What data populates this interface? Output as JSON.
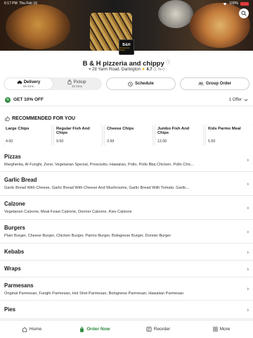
{
  "status_bar": {
    "time": "6:17 PM",
    "date": "Thu Feb 16",
    "battery": "100%"
  },
  "restaurant": {
    "logo_text": "B&H",
    "logo_sub": "Pizzeria and Chippy",
    "name": "B & H pizzeria and chippy",
    "address": "28 Yarm Road, Darlington",
    "rating": "4.7",
    "rating_count": "(1.7k+)"
  },
  "order_mode": {
    "delivery_label": "Delivery",
    "delivery_time": "55 mins",
    "pickup_label": "Pickup",
    "pickup_time": "20 mins",
    "schedule_label": "Schedule",
    "group_order_label": "Group Order"
  },
  "offer": {
    "label": "GET 10% OFF",
    "count_label": "1 Offer"
  },
  "recommended": {
    "heading": "RECOMMENDED FOR YOU",
    "items": [
      {
        "name": "Large Chips",
        "price": "4.00"
      },
      {
        "name": "Regular Fish And Chips",
        "price": "9.50"
      },
      {
        "name": "Cheese Chips",
        "price": "3.99"
      },
      {
        "name": "Jumbo Fish And Chips",
        "price": "12.00"
      },
      {
        "name": "Kids Parmo Meal",
        "price": "5.50"
      }
    ]
  },
  "categories": [
    {
      "name": "Pizzas",
      "items": "Margherita, Al Funghi, Zeno, Vegetarian Special, Prosciutto, Hawaiian, Pollo, Pollo Bbq Chicken, Pollo Chic..."
    },
    {
      "name": "Garlic Bread",
      "items": "Garlic Bread With Cheese, Garlic Bread With Cheese And Mushrooms, Garlic Bread With Tomato, Garlic..."
    },
    {
      "name": "Calzone",
      "items": "Vegetarian Calzone, Meat Feast Calzone, Donner Calzone, Kiev Calzone"
    },
    {
      "name": "Burgers",
      "items": "Plain Burger, Cheese Burger, Chicken Burger, Parmo Burger, Bolognese Burger, Donner Burger"
    },
    {
      "name": "Kebabs",
      "items": ""
    },
    {
      "name": "Wraps",
      "items": ""
    },
    {
      "name": "Parmesans",
      "items": "Original Parmesan, Funghi Parmesan, Hot Shot Parmesan, Bolognese Parmesan, Hawaiian Parmesan"
    },
    {
      "name": "Pies",
      "items": ""
    }
  ],
  "bottom_nav": {
    "home": "Home",
    "order_now": "Order Now",
    "reorder": "Reorder",
    "more": "More"
  },
  "colors": {
    "accent": "#2d8a3e",
    "star": "#f0b400",
    "battery": "#e23b3b"
  }
}
